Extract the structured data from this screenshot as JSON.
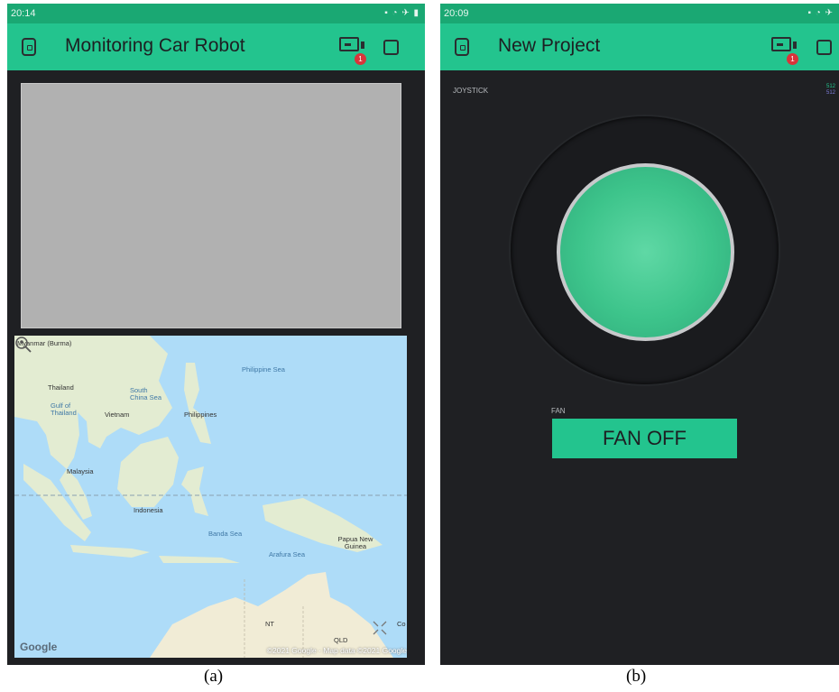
{
  "panel_a": {
    "status_time": "20:14",
    "app_title": "Monitoring Car Robot",
    "device_badge": "1",
    "map": {
      "labels": {
        "myanmar": "Myanmar (Burma)",
        "thailand": "Thailand",
        "south_china_sea": "South China Sea",
        "philippine_sea": "Philippine Sea",
        "vietnam": "Vietnam",
        "philippines": "Philippines",
        "gulf_of_thailand": "Gulf of Thailand",
        "malaysia": "Malaysia",
        "indonesia": "Indonesia",
        "banda_sea": "Banda Sea",
        "papua_new_guinea": "Papua New Guinea",
        "arafura_sea": "Arafura Sea",
        "nt": "NT",
        "qld": "QLD",
        "co": "Co"
      },
      "google_logo": "Google",
      "copyright": "©2021 Google · Map data ©2021 Google"
    },
    "caption": "(a)"
  },
  "panel_b": {
    "status_time": "20:09",
    "app_title": "New Project",
    "device_badge": "1",
    "joystick": {
      "label": "JOYSTICK",
      "x_value": "512",
      "y_value": "512"
    },
    "fan": {
      "label": "FAN",
      "button_label": "FAN OFF"
    },
    "caption": "(b)"
  },
  "colors": {
    "accent": "#23c48e",
    "background": "#1f2023"
  }
}
